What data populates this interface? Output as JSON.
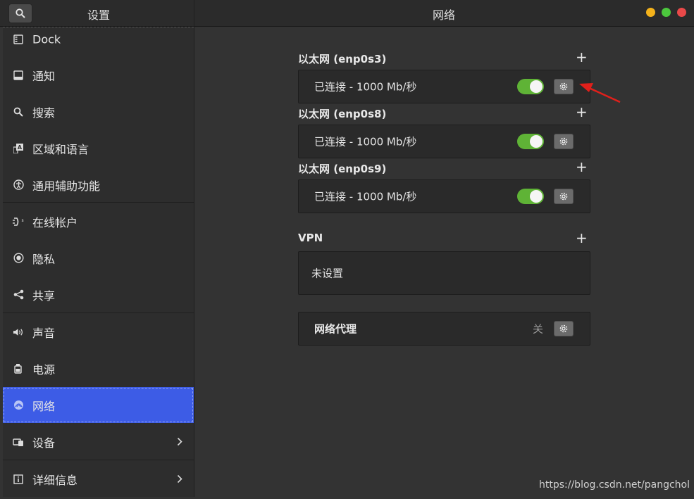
{
  "header": {
    "left_title": "设置",
    "center_title": "网络",
    "search_icon": "search-icon"
  },
  "sidebar": {
    "items": [
      {
        "label": "Dock",
        "icon": "dock-icon"
      },
      {
        "label": "通知",
        "icon": "notification-icon"
      },
      {
        "label": "搜索",
        "icon": "search-icon"
      },
      {
        "label": "区域和语言",
        "icon": "region-language-icon"
      },
      {
        "label": "通用辅助功能",
        "icon": "accessibility-icon"
      },
      {
        "label": "在线帐户",
        "icon": "online-accounts-icon"
      },
      {
        "label": "隐私",
        "icon": "privacy-icon"
      },
      {
        "label": "共享",
        "icon": "share-icon"
      },
      {
        "label": "声音",
        "icon": "sound-icon"
      },
      {
        "label": "电源",
        "icon": "power-icon"
      },
      {
        "label": "网络",
        "icon": "network-icon",
        "active": true
      },
      {
        "label": "设备",
        "icon": "devices-icon",
        "has_chevron": true
      },
      {
        "label": "详细信息",
        "icon": "details-icon",
        "has_chevron": true
      }
    ]
  },
  "main": {
    "ethernet": [
      {
        "title": "以太网 (enp0s3)",
        "status": "已连接 - 1000 Mb/秒",
        "enabled": true
      },
      {
        "title": "以太网 (enp0s8)",
        "status": "已连接 - 1000 Mb/秒",
        "enabled": true
      },
      {
        "title": "以太网 (enp0s9)",
        "status": "已连接 - 1000 Mb/秒",
        "enabled": true
      }
    ],
    "add_symbol": "+",
    "vpn": {
      "title": "VPN",
      "status": "未设置"
    },
    "proxy": {
      "title": "网络代理",
      "status": "关"
    }
  },
  "watermark": "https://blog.csdn.net/pangchol",
  "colors": {
    "accent": "#3d5ce6",
    "toggle_on": "#5fb336",
    "arrow": "#e0201b"
  }
}
